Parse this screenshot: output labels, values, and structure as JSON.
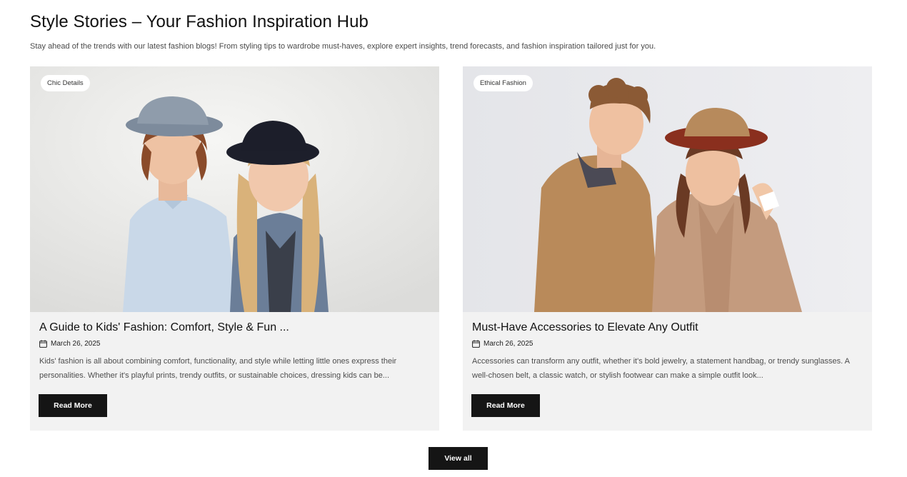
{
  "section": {
    "title": "Style Stories – Your Fashion Inspiration Hub",
    "subtitle": "Stay ahead of the trends with our latest fashion blogs! From styling tips to wardrobe must-haves, explore expert insights, trend forecasts, and fashion inspiration tailored just for you."
  },
  "posts": [
    {
      "category": "Chic Details",
      "title": "A Guide to Kids' Fashion: Comfort, Style & Fun ...",
      "date": "March 26, 2025",
      "excerpt": "Kids' fashion is all about combining comfort, functionality, and style while letting little ones express their personalities. Whether it's playful prints, trendy outfits, or sustainable choices, dressing kids can be...",
      "button_label": "Read More",
      "image_icon": "photo-two-kids-in-hats-icon"
    },
    {
      "category": "Ethical Fashion",
      "title": "Must-Have Accessories to Elevate Any Outfit",
      "date": "March 26, 2025",
      "excerpt": "Accessories can transform any outfit, whether it's bold jewelry, a statement handbag, or trendy sunglasses. A well-chosen belt, a classic watch, or stylish footwear can make a simple outfit look...",
      "button_label": "Read More",
      "image_icon": "photo-couple-in-camel-coats-icon"
    }
  ],
  "view_all_label": "View all",
  "icons": {
    "date": "calendar-icon"
  },
  "colors": {
    "button_bg": "#151515",
    "card_bg": "#f2f2f2",
    "badge_bg": "#ffffff"
  }
}
